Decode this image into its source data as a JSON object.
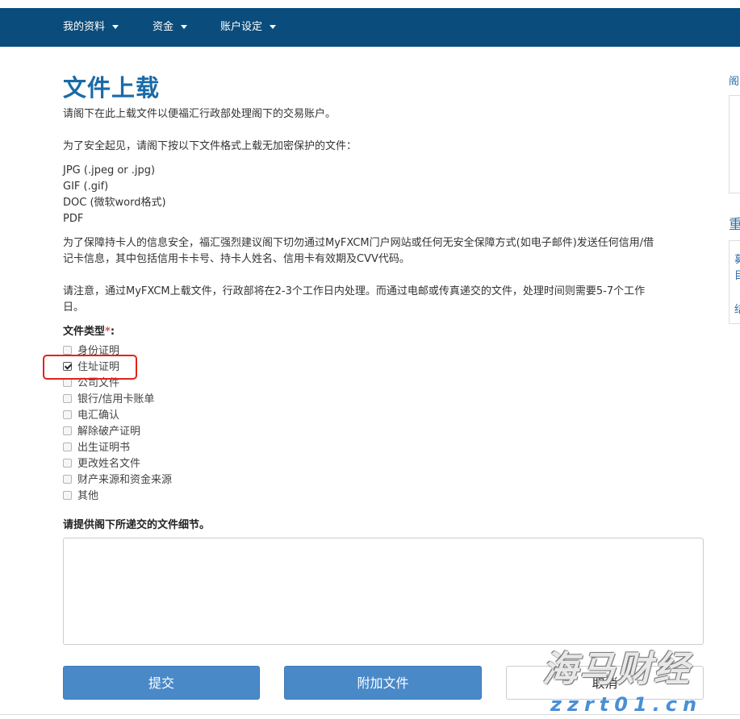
{
  "nav": {
    "items": [
      {
        "label": "我的资料"
      },
      {
        "label": "资金"
      },
      {
        "label": "账户设定"
      }
    ]
  },
  "page": {
    "title": "文件上载",
    "intro": "请阁下在此上载文件以便福汇行政部处理阁下的交易账户。",
    "formats_intro": "为了安全起见，请阁下按以下文件格式上载无加密保护的文件：",
    "formats": [
      "JPG (.jpeg or .jpg)",
      "GIF (.gif)",
      "DOC (微软word格式)",
      "PDF"
    ],
    "security_note": [
      "为了保障持卡人的信息安全，福汇强烈建议阁下切勿通过MyFXCM门户网站或任何无安全保障方式(如电子邮件)发送任何信用/借",
      "记卡信息，其中包括信用卡卡号、持卡人姓名、信用卡有效期及CVV代码。"
    ],
    "processing_note": [
      "请注意，通过MyFXCM上载文件，行政部将在2-3个工作日内处理。而通过电邮或传真递交的文件，处理时间则需要5-7个工作",
      "日。"
    ]
  },
  "file_type": {
    "label": "文件类型",
    "required_mark": "*",
    "suffix": ":",
    "options": [
      {
        "label": "身份证明",
        "checked": false
      },
      {
        "label": "住址证明",
        "checked": true
      },
      {
        "label": "公司文件",
        "checked": false
      },
      {
        "label": "银行/信用卡账单",
        "checked": false
      },
      {
        "label": "电汇确认",
        "checked": false
      },
      {
        "label": "解除破产证明",
        "checked": false
      },
      {
        "label": "出生证明书",
        "checked": false
      },
      {
        "label": "更改姓名文件",
        "checked": false
      },
      {
        "label": "财产来源和资金来源",
        "checked": false
      },
      {
        "label": "其他",
        "checked": false
      }
    ]
  },
  "details": {
    "label": "请提供阁下所递交的文件细节。",
    "value": ""
  },
  "buttons": {
    "submit": "提交",
    "attach": "附加文件",
    "cancel": "取消"
  },
  "sidebar": {
    "top_label": "阁",
    "section_label": "重",
    "item1_a": "募",
    "item1_b": "目",
    "item2": "结"
  },
  "watermark": {
    "brand": "海马财经",
    "domain": "zzrt01.cn"
  },
  "colors": {
    "nav_bg": "#0a4d7c",
    "title": "#1a6aa7",
    "primary_button": "#4a89c8",
    "highlight": "#e2231a"
  }
}
